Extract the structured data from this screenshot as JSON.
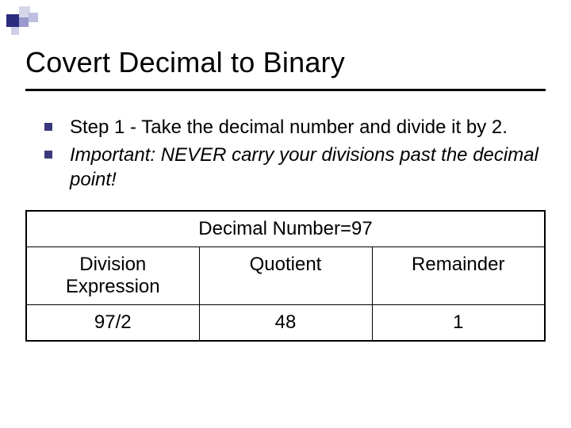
{
  "title": "Covert Decimal to Binary",
  "bullets": [
    {
      "text": "Step 1 - Take the decimal number and divide it by 2.",
      "italic": false
    },
    {
      "text": "Important: NEVER carry your divisions past the decimal point!",
      "italic": true
    }
  ],
  "table_header": "Decimal Number=97",
  "columns": [
    "Division Expression",
    "Quotient",
    "Remainder"
  ],
  "row": {
    "expr": "97/2",
    "quotient": "48",
    "remainder": "1"
  },
  "chart_data": {
    "type": "table",
    "title": "Decimal Number=97",
    "columns": [
      "Division Expression",
      "Quotient",
      "Remainder"
    ],
    "rows": [
      [
        "97/2",
        48,
        1
      ]
    ]
  }
}
